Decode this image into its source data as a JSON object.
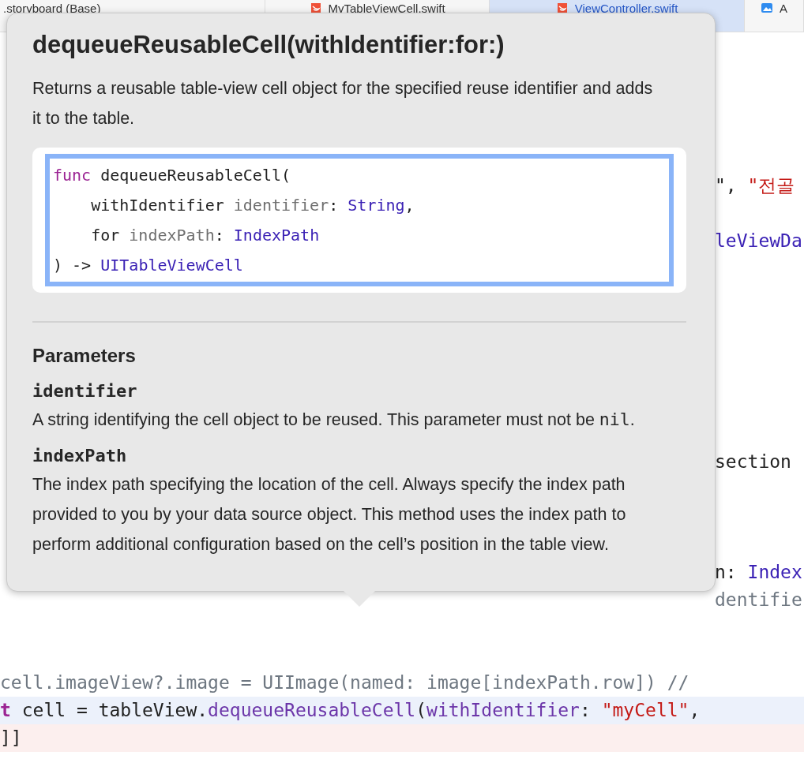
{
  "tabs": [
    {
      "label": ".storyboard (Base)",
      "selected": false
    },
    {
      "label": "MyTableViewCell.swift",
      "selected": false
    },
    {
      "label": "ViewController.swift",
      "selected": true
    },
    {
      "label": "A",
      "selected": false
    }
  ],
  "code_lines": [
    {
      "kind": "fragment",
      "tokens": [
        {
          "text": "\", ",
          "kind": "plain"
        },
        {
          "text": "\"전골",
          "kind": "string"
        }
      ]
    },
    {
      "kind": "fragment",
      "tokens": [
        {
          "text": "leViewDa",
          "kind": "type"
        }
      ]
    },
    {
      "kind": "fragment",
      "tokens": [
        {
          "text": "section",
          "kind": "plain"
        }
      ]
    },
    {
      "kind": "fragment",
      "tokens": [
        {
          "text": "n: ",
          "kind": "plain"
        },
        {
          "text": "Index",
          "kind": "type"
        }
      ]
    },
    {
      "kind": "fragment",
      "tokens": [
        {
          "text": "dentifie",
          "kind": "dim"
        }
      ]
    },
    {
      "kind": "line",
      "tokens": [
        {
          "text": "cell.imageView?.image = UIImage(named: image[indexPath.row]) //",
          "kind": "dim"
        }
      ]
    },
    {
      "kind": "current",
      "tokens": [
        {
          "text": "t",
          "kind": "keyword"
        },
        {
          "text": " cell = tableView.",
          "kind": "plain"
        },
        {
          "text": "dequeueReusableCell",
          "kind": "method"
        },
        {
          "text": "(",
          "kind": "plain"
        },
        {
          "text": "withIdentifier",
          "kind": "method"
        },
        {
          "text": ": ",
          "kind": "plain"
        },
        {
          "text": "\"myCell\"",
          "kind": "string"
        },
        {
          "text": ",",
          "kind": "plain"
        }
      ]
    },
    {
      "kind": "error",
      "tokens": [
        {
          "text": "]]",
          "kind": "plain"
        }
      ]
    }
  ],
  "popover": {
    "title": "dequeueReusableCell(withIdentifier:for:)",
    "summary": "Returns a reusable table-view cell object for the specified reuse identifier and adds it to the table.",
    "declaration": [
      [
        {
          "text": "func",
          "kind": "keyword"
        },
        {
          "text": " dequeueReusableCell(",
          "kind": "plain"
        }
      ],
      [
        {
          "text": "    withIdentifier ",
          "kind": "plain"
        },
        {
          "text": "identifier",
          "kind": "param"
        },
        {
          "text": ": ",
          "kind": "plain"
        },
        {
          "text": "String",
          "kind": "type"
        },
        {
          "text": ",",
          "kind": "plain"
        }
      ],
      [
        {
          "text": "    for ",
          "kind": "plain"
        },
        {
          "text": "indexPath",
          "kind": "param"
        },
        {
          "text": ": ",
          "kind": "plain"
        },
        {
          "text": "IndexPath",
          "kind": "type"
        }
      ],
      [
        {
          "text": ") -> ",
          "kind": "plain"
        },
        {
          "text": "UITableViewCell",
          "kind": "type"
        }
      ]
    ],
    "parameters_heading": "Parameters",
    "parameters": [
      {
        "name": "identifier",
        "description": [
          {
            "text": "A string identifying the cell object to be reused. This parameter must not be ",
            "kind": "text"
          },
          {
            "text": "nil",
            "kind": "code"
          },
          {
            "text": ".",
            "kind": "text"
          }
        ]
      },
      {
        "name": "indexPath",
        "description": [
          {
            "text": "The index path specifying the location of the cell. Always specify the index path provided to you by your data source object. This method uses the index path to perform additional configuration based on the cell’s position in the table view.",
            "kind": "text"
          }
        ]
      }
    ]
  }
}
